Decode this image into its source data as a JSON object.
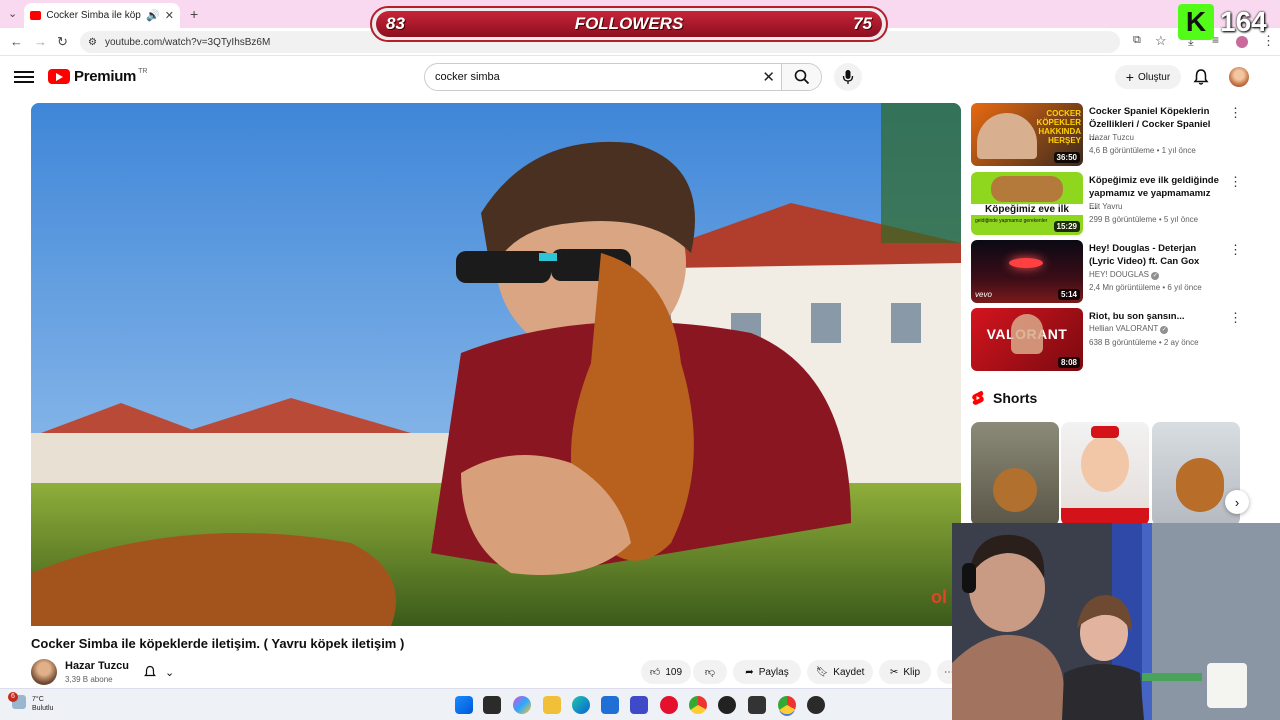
{
  "browser": {
    "tab_title": "Cocker Simba ile köpeklerde",
    "url": "youtube.com/watch?v=3QTyIhsBz6M"
  },
  "stream_overlay": {
    "followers_label": "FOLLOWERS",
    "followers_left": "83",
    "followers_right": "75",
    "kick_letter": "K",
    "kick_count": "164"
  },
  "youtube": {
    "logo_text": "Premium",
    "country_code": "TR",
    "search_value": "cocker simba",
    "create_label": "Oluştur"
  },
  "video": {
    "title": "Cocker Simba ile köpeklerde iletişim. ( Yavru köpek iletişim )",
    "channel": "Hazar Tuzcu",
    "subscribers": "3,39 B abone",
    "likes": "109",
    "share_label": "Paylaş",
    "save_label": "Kaydet",
    "clip_label": "Klip",
    "watermark": "Abone ol"
  },
  "recommendations": [
    {
      "title": "Cocker Spaniel Köpeklerin Özellikleri / Cocker Spaniel ...",
      "channel": "Hazar Tuzcu",
      "meta": "4,6 B görüntüleme • 1 yıl önce",
      "duration": "36:50",
      "thumb_text": "COCKER KÖPEKLER HAKKINDA HERŞEY",
      "verified": false
    },
    {
      "title": "Köpeğimiz eve ilk geldiğinde yapmamız ve yapmamamız ...",
      "channel": "Elit Yavru",
      "meta": "299 B görüntüleme • 5 yıl önce",
      "duration": "15:29",
      "thumb_text": "Köpeğimiz eve ilk",
      "thumb_sub": "geldiğinde yapmamız gerekenler",
      "verified": false
    },
    {
      "title": "Hey! Douglas - Deterjan (Lyric Video) ft. Can Gox",
      "channel": "HEY! DOUGLAS",
      "meta": "2,4 Mn görüntüleme • 6 yıl önce",
      "duration": "5:14",
      "thumb_text": "vevo",
      "verified": true
    },
    {
      "title": "Riot, bu son şansın...",
      "channel": "Hellian VALORANT",
      "meta": "638 B görüntüleme • 2 ay önce",
      "duration": "8:08",
      "thumb_text": "VALORANT",
      "verified": true
    }
  ],
  "shorts": {
    "heading": "Shorts"
  },
  "taskbar": {
    "temperature": "7°C",
    "condition": "Bulutlu",
    "notification_count": "6"
  },
  "colors": {
    "youtube_red": "#ff0000",
    "tab_strip": "#f9d9ef",
    "kick_green": "#53fc18"
  }
}
